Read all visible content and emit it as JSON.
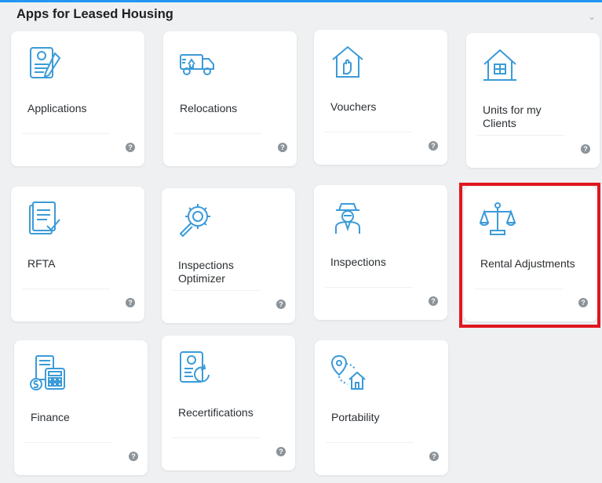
{
  "header": {
    "title": "Apps for Leased Housing",
    "collapse_icon": "chevron-down-icon"
  },
  "accent_color": "#2196f3",
  "highlight_color": "#e0161f",
  "tiles": [
    {
      "label": "Applications",
      "icon": "application-form-icon",
      "info": "?"
    },
    {
      "label": "Relocations",
      "icon": "moving-truck-icon",
      "info": "?"
    },
    {
      "label": "Vouchers",
      "icon": "house-hand-icon",
      "info": "?"
    },
    {
      "label": "Units for my\nClients",
      "icon": "house-icon",
      "info": "?"
    },
    {
      "label": "RFTA",
      "icon": "document-check-icon",
      "info": "?"
    },
    {
      "label": "Inspections\nOptimizer",
      "icon": "gear-magnifier-icon",
      "info": "?"
    },
    {
      "label": "Inspections",
      "icon": "inspector-icon",
      "info": "?"
    },
    {
      "label": "Rental Adjustments",
      "icon": "scales-icon",
      "info": "?"
    },
    {
      "label": "Finance",
      "icon": "calculator-icon",
      "info": "?"
    },
    {
      "label": "Recertifications",
      "icon": "profile-refresh-icon",
      "info": "?"
    },
    {
      "label": "Portability",
      "icon": "location-house-icon",
      "info": "?"
    }
  ]
}
